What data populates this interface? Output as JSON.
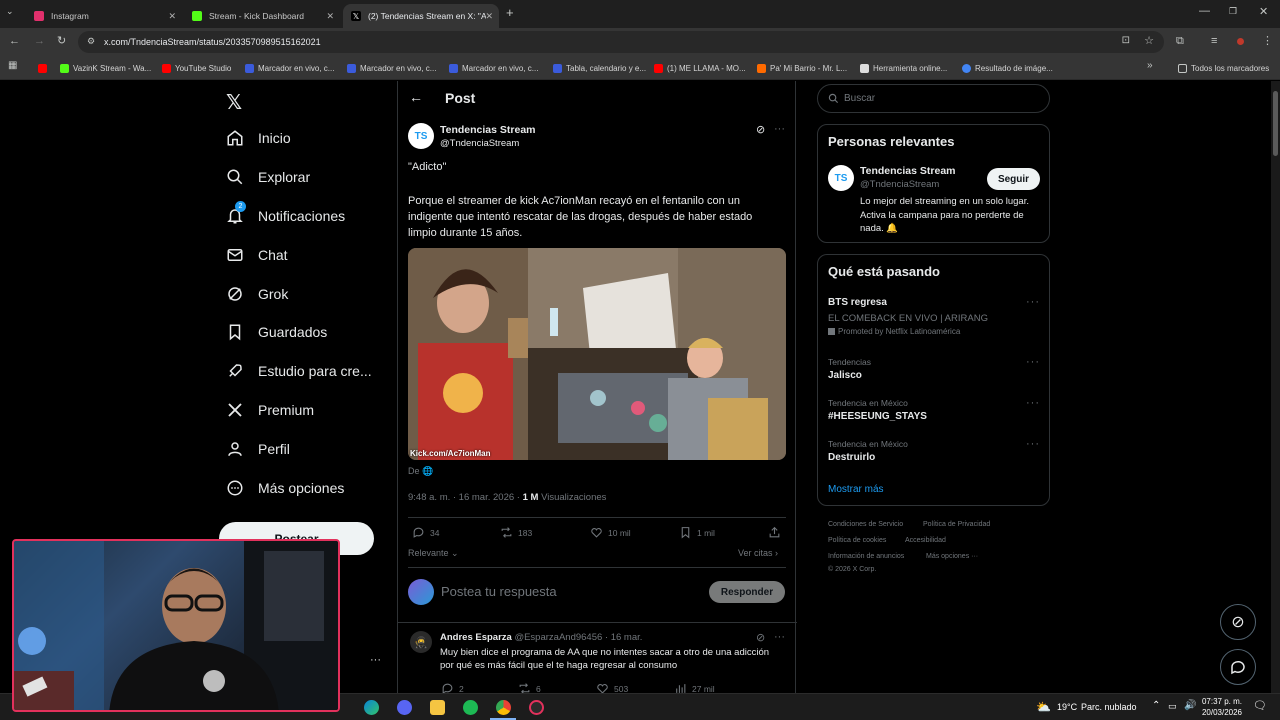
{
  "browser": {
    "tabs": [
      {
        "title": "Instagram",
        "fav_color": "#e1306c"
      },
      {
        "title": "Stream - Kick Dashboard",
        "fav_color": "#53fc18"
      },
      {
        "title": "(2) Tendencias Stream en X: \"A",
        "fav_color": "#000000"
      }
    ],
    "url": "x.com/TndenciaStream/status/2033570989515162021",
    "bookmarks": [
      {
        "label": "",
        "color": "#ff0000"
      },
      {
        "label": "VazinK Stream - Wa...",
        "color": "#53fc18"
      },
      {
        "label": "YouTube Studio",
        "color": "#ff0000"
      },
      {
        "label": "Marcador en vivo, c...",
        "color": "#3b5bdb"
      },
      {
        "label": "Marcador en vivo, c...",
        "color": "#3b5bdb"
      },
      {
        "label": "Marcador en vivo, c...",
        "color": "#3b5bdb"
      },
      {
        "label": "Tabla, calendario y e...",
        "color": "#3b5bdb"
      },
      {
        "label": "(1) ME LLAMA - MO...",
        "color": "#ff0000"
      },
      {
        "label": "Pa' Mi Barrio - Mr. L...",
        "color": "#ff6a00"
      },
      {
        "label": "Herramienta online...",
        "color": "#dddddd"
      },
      {
        "label": "Resultado de imáge...",
        "color": "#4285f4"
      }
    ],
    "all_bookmarks": "Todos los marcadores"
  },
  "sidebar": {
    "items": [
      {
        "label": "Inicio",
        "icon": "home-icon"
      },
      {
        "label": "Explorar",
        "icon": "search-icon"
      },
      {
        "label": "Notificaciones",
        "icon": "bell-icon",
        "badge": "2"
      },
      {
        "label": "Chat",
        "icon": "mail-icon"
      },
      {
        "label": "Grok",
        "icon": "grok-icon"
      },
      {
        "label": "Guardados",
        "icon": "bookmark-icon"
      },
      {
        "label": "Estudio para cre...",
        "icon": "rocket-icon"
      },
      {
        "label": "Premium",
        "icon": "x-icon"
      },
      {
        "label": "Perfil",
        "icon": "user-icon"
      },
      {
        "label": "Más opciones",
        "icon": "more-circle-icon"
      }
    ],
    "post_button": "Postear"
  },
  "post": {
    "header": "Post",
    "author_name": "Tendencias Stream",
    "author_handle": "@TndenciaStream",
    "text_line1": "\"Adicto\"",
    "text_body": "Porque el streamer de kick Ac7ionMan recayó en el fentanilo con un indigente que intentó rescatar de las drogas, después de haber estado limpio durante 15 años.",
    "image_watermark": "Kick.com/Ac7ionMan",
    "from_label": "De",
    "timestamp": "9:48 a. m. · 16 mar. 2026 ·",
    "views_count": "1 M",
    "views_label": "Visualizaciones",
    "replies": "34",
    "reposts": "183",
    "likes": "10 mil",
    "bookmarks": "1 mil",
    "sort_label": "Relevante",
    "quotes_label": "Ver citas",
    "reply_placeholder": "Postea tu respuesta",
    "reply_button": "Responder"
  },
  "reply": {
    "name": "Andres Esparza",
    "handle": "@EsparzaAnd96456 · 16 mar.",
    "text": "Muy bien dice el programa de AA que no intentes sacar a otro de una adicción por qué es más fácil que el te haga regresar al consumo",
    "replies": "2",
    "reposts": "6",
    "likes": "503",
    "views": "27 mil"
  },
  "right": {
    "search_placeholder": "Buscar",
    "relevant_title": "Personas relevantes",
    "relevant_name": "Tendencias Stream",
    "relevant_handle": "@TndenciaStream",
    "follow_button": "Seguir",
    "relevant_bio": "Lo mejor del streaming en un solo lugar. Activa la campana para no perderte de nada. 🔔",
    "trending_title": "Qué está pasando",
    "trends": [
      {
        "category": "",
        "name": "BTS regresa",
        "sub": "EL COMEBACK EN VIVO | ARIRANG",
        "promo": "Promoted by Netflix Latinoamérica"
      },
      {
        "category": "Tendencias",
        "name": "Jalisco"
      },
      {
        "category": "Tendencia en México",
        "name": "#HEESEUNG_STAYS"
      },
      {
        "category": "Tendencia en México",
        "name": "Destruirlo"
      }
    ],
    "show_more": "Mostrar más",
    "footer": {
      "terms": "Condiciones de Servicio",
      "privacy": "Política de Privacidad",
      "cookies": "Política de cookies",
      "accessibility": "Accesibilidad",
      "ads": "Información de anuncios",
      "more": "Más opciones ···",
      "copyright": "© 2026 X Corp."
    }
  },
  "taskbar": {
    "temperature": "19°C",
    "weather": "Parc. nublado",
    "time": "07:37 p. m.",
    "date": "20/03/2026"
  }
}
